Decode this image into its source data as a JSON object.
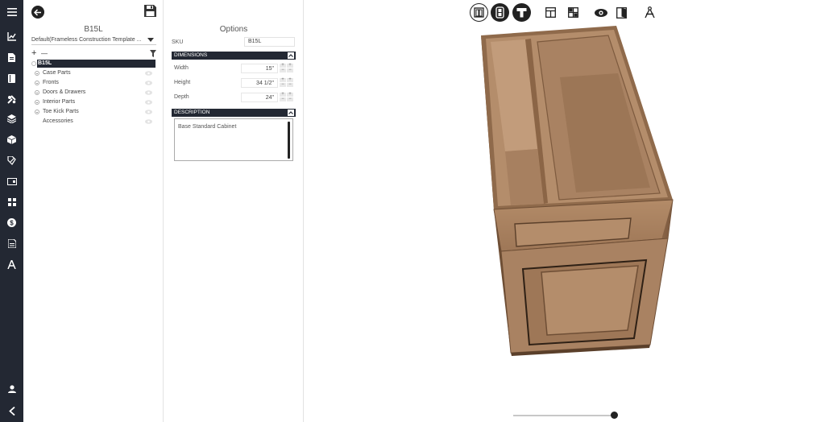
{
  "nav": {
    "items": [
      {
        "name": "menu-icon"
      },
      {
        "name": "chart-icon"
      },
      {
        "name": "document-icon"
      },
      {
        "name": "book-icon"
      },
      {
        "name": "tools-icon"
      },
      {
        "name": "layers-icon"
      },
      {
        "name": "box-icon"
      },
      {
        "name": "tag-edit-icon"
      },
      {
        "name": "card-icon"
      },
      {
        "name": "grid-icon"
      },
      {
        "name": "dollar-icon"
      },
      {
        "name": "report-icon"
      },
      {
        "name": "compass-icon"
      },
      {
        "name": "user-icon"
      },
      {
        "name": "collapse-left-icon"
      }
    ]
  },
  "tree_panel": {
    "title": "B15L",
    "template": "Default(Frameless Construction Template ...",
    "tools": {
      "expand": "+",
      "collapse": "—"
    },
    "root": "B15L",
    "items": [
      "Case Parts",
      "Fronts",
      "Doors & Drawers",
      "Interior Parts",
      "Toe Kick Parts",
      "Accessories"
    ]
  },
  "options_panel": {
    "title": "Options",
    "sku": {
      "label": "SKU",
      "value": "B15L"
    },
    "dimensions": {
      "header": "DIMENSIONS",
      "rows": [
        {
          "label": "Width",
          "value": "15\""
        },
        {
          "label": "Height",
          "value": "34 1/2\""
        },
        {
          "label": "Depth",
          "value": "24\""
        }
      ]
    },
    "description": {
      "header": "DESCRIPTION",
      "text": "Base Standard Cabinet"
    }
  },
  "viewer": {
    "toolbar": [
      {
        "name": "front-view-icon"
      },
      {
        "name": "side-view-icon"
      },
      {
        "name": "top-view-icon"
      },
      {
        "name": "layout-icon"
      },
      {
        "name": "split-layout-icon"
      },
      {
        "name": "eye-icon"
      },
      {
        "name": "door-open-icon"
      },
      {
        "name": "dimension-compass-icon"
      }
    ],
    "colors": {
      "wood": "#a67c5b",
      "wood_dark": "#7d5a3e",
      "wood_light": "#c09a78",
      "accent": "#232833"
    }
  }
}
